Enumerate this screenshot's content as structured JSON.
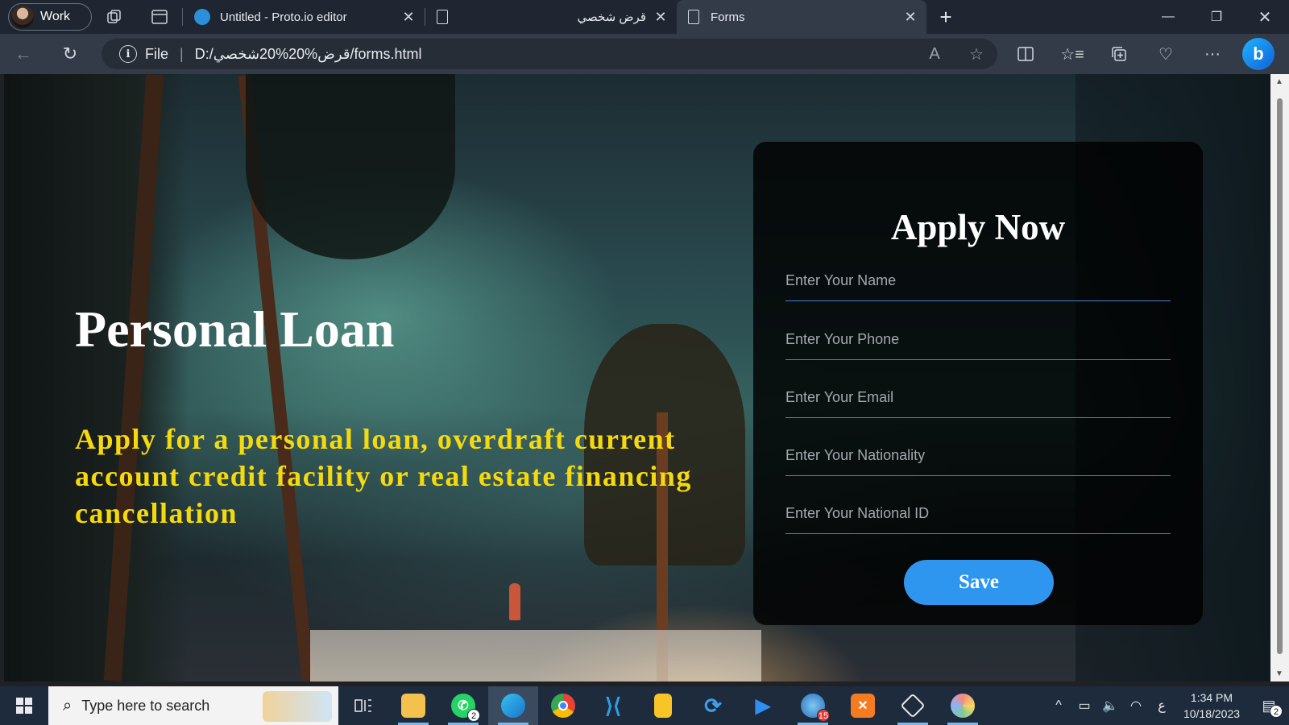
{
  "browser": {
    "profile_label": "Work",
    "tabs": [
      {
        "title": "Untitled - Proto.io editor"
      },
      {
        "title": "قرض شخصي"
      },
      {
        "title": "Forms"
      }
    ],
    "address": {
      "file_label": "File",
      "url": "D:/قرض%20%20شخصي/forms.html"
    }
  },
  "page": {
    "hero": {
      "title": "Personal Loan",
      "subtitle": "Apply for a personal loan, overdraft current account credit facility or real estate financing cancellation"
    },
    "form": {
      "title": "Apply Now",
      "fields": [
        {
          "placeholder": "Enter Your Name"
        },
        {
          "placeholder": "Enter Your Phone"
        },
        {
          "placeholder": "Enter Your Email"
        },
        {
          "placeholder": "Enter Your Nationality"
        },
        {
          "placeholder": "Enter Your National ID"
        }
      ],
      "save_label": "Save"
    },
    "colors": {
      "subtitle": "#f5d90f",
      "button": "#2f96f0",
      "field_underline": "#4d7fd6"
    }
  },
  "taskbar": {
    "search_placeholder": "Type here to search",
    "whatsapp_badge": "2",
    "app_badge_count": "15",
    "keyboard_lang": "ع",
    "time": "1:34 PM",
    "date": "10/18/2023",
    "notification_count": "2"
  }
}
